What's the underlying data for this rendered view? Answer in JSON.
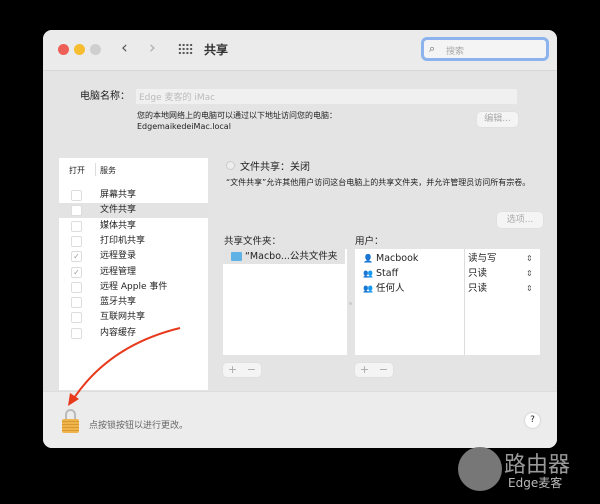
{
  "window": {
    "title": "共享",
    "search_placeholder": "搜索"
  },
  "computer_name": {
    "label": "电脑名称：",
    "value": "Edge 麦客的 iMac",
    "note": "您的本地网络上的电脑可以通过以下地址访问您的电脑：",
    "address": "EdgemaikedeiMac.local",
    "edit_button": "编辑..."
  },
  "services": {
    "col_on": "打开",
    "col_service": "服务",
    "items": [
      {
        "label": "屏幕共享",
        "checked": false
      },
      {
        "label": "文件共享",
        "checked": false,
        "selected": true
      },
      {
        "label": "媒体共享",
        "checked": false
      },
      {
        "label": "打印机共享",
        "checked": false
      },
      {
        "label": "远程登录",
        "checked": true
      },
      {
        "label": "远程管理",
        "checked": true
      },
      {
        "label": "远程 Apple 事件",
        "checked": false
      },
      {
        "label": "蓝牙共享",
        "checked": false
      },
      {
        "label": "互联网共享",
        "checked": false
      },
      {
        "label": "内容缓存",
        "checked": false
      }
    ]
  },
  "detail": {
    "status": "文件共享：关闭",
    "description": "“文件共享”允许其他用户访问这台电脑上的共享文件夹，并允许管理员访问所有宗卷。",
    "options_button": "选项...",
    "folders_label": "共享文件夹：",
    "folders": [
      "“Macbo...公共文件夹"
    ],
    "users_label": "用户：",
    "users": [
      {
        "name": "Macbook",
        "perm": "读与写",
        "icon": "user-icon"
      },
      {
        "name": "Staff",
        "perm": "只读",
        "icon": "group-icon"
      },
      {
        "name": "任何人",
        "perm": "只读",
        "icon": "everyone-icon"
      }
    ],
    "plus": "+",
    "minus": "−"
  },
  "footer": {
    "lock_text": "点按锁按钮以进行更改。",
    "help": "?"
  },
  "watermark": {
    "line1": "路由器",
    "line2": "Edge麦客"
  },
  "colors": {
    "accent": "#8cb3ee",
    "arrow": "#e8391c"
  }
}
